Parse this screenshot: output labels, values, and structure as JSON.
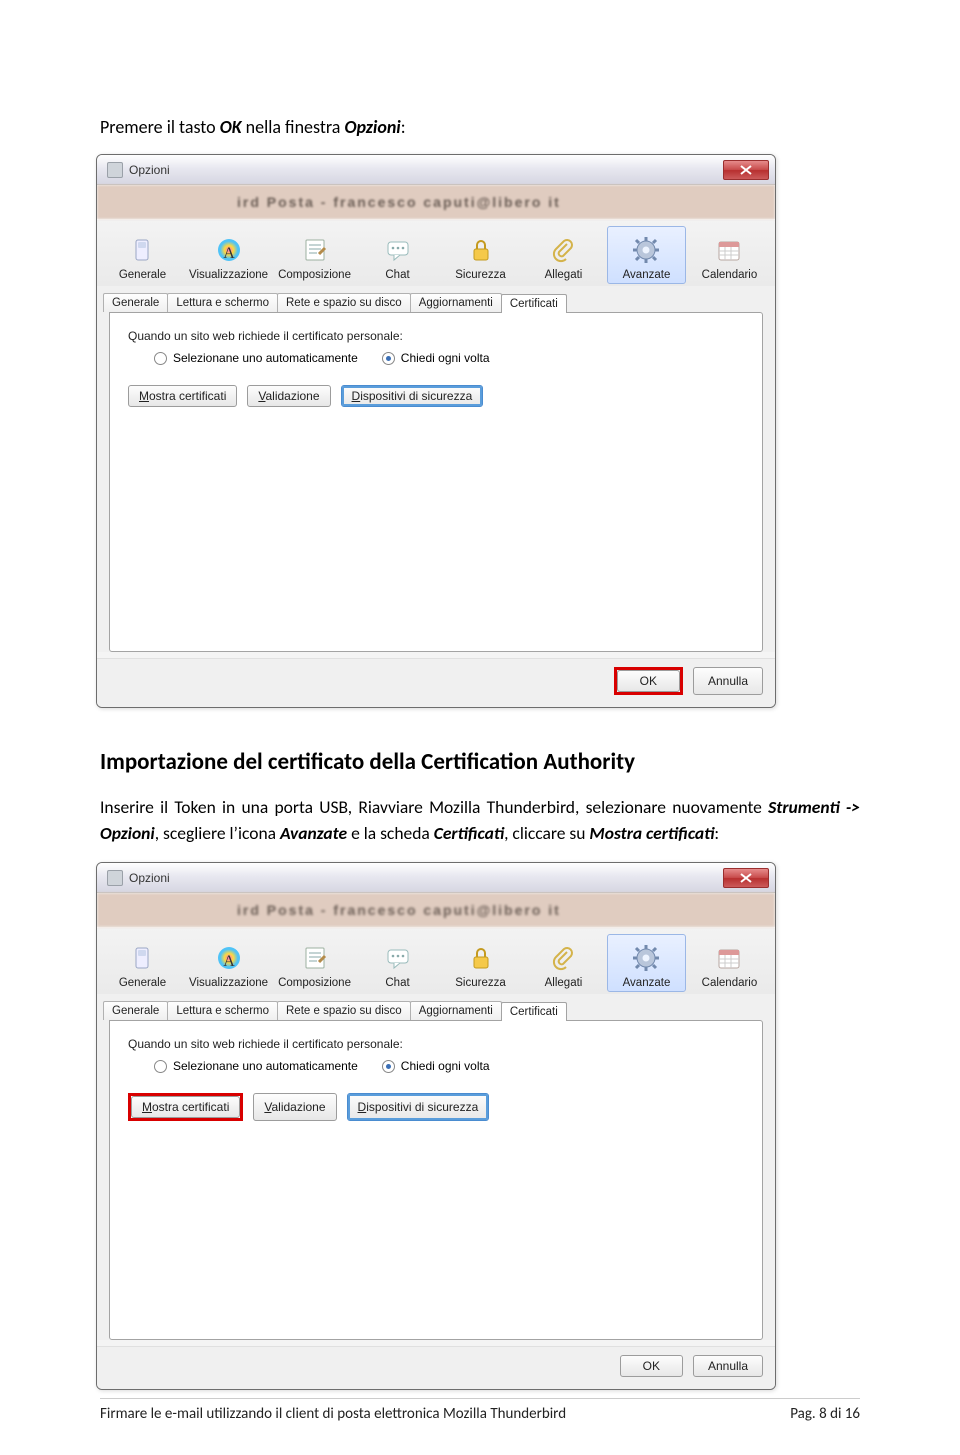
{
  "intro": {
    "text_prefix": "Premere il tasto ",
    "bold1": "OK",
    "text_mid": " nella finestra ",
    "bold2": "Opzioni",
    "text_suffix": ":"
  },
  "heading2": "Importazione del certificato della Certification Authority",
  "paragraph2": {
    "seg1": "Inserire il Token in una porta USB, Riavviare Mozilla Thunderbird, selezionare nuovamente ",
    "bolditalic1": "Strumenti -> Opzioni",
    "seg2": ", scegliere l’icona ",
    "bolditalic2": "Avanzate",
    "seg3": " e la scheda ",
    "bolditalic3": "Certificati",
    "seg4": ", cliccare su ",
    "bolditalic4": "Mostra certificati",
    "seg5": ":"
  },
  "dialog": {
    "title": "Opzioni",
    "blurred_bg": "ird  Posta  -  francesco caputi@libero it",
    "toolbar": [
      {
        "label": "Generale"
      },
      {
        "label": "Visualizzazione"
      },
      {
        "label": "Composizione"
      },
      {
        "label": "Chat"
      },
      {
        "label": "Sicurezza"
      },
      {
        "label": "Allegati"
      },
      {
        "label": "Avanzate"
      },
      {
        "label": "Calendario"
      }
    ],
    "subtabs": [
      "Generale",
      "Lettura e schermo",
      "Rete e spazio su disco",
      "Aggiornamenti",
      "Certificati"
    ],
    "active_subtab": "Certificati",
    "cert_label": "Quando un sito web richiede il certificato personale:",
    "radio1": "Selezionane uno automaticamente",
    "radio2": "Chiedi ogni volta",
    "btn_mostra": "Mostra certificati",
    "btn_mostra_u": "M",
    "btn_valid": "Validazione",
    "btn_valid_u": "V",
    "btn_disp": "Dispositivi di sicurezza",
    "btn_disp_u": "D",
    "btn_ok": "OK",
    "btn_cancel": "Annulla"
  },
  "footer": {
    "left": "Firmare le e-mail utilizzando il client di posta elettronica Mozilla Thunderbird",
    "right": "Pag. 8 di 16"
  }
}
